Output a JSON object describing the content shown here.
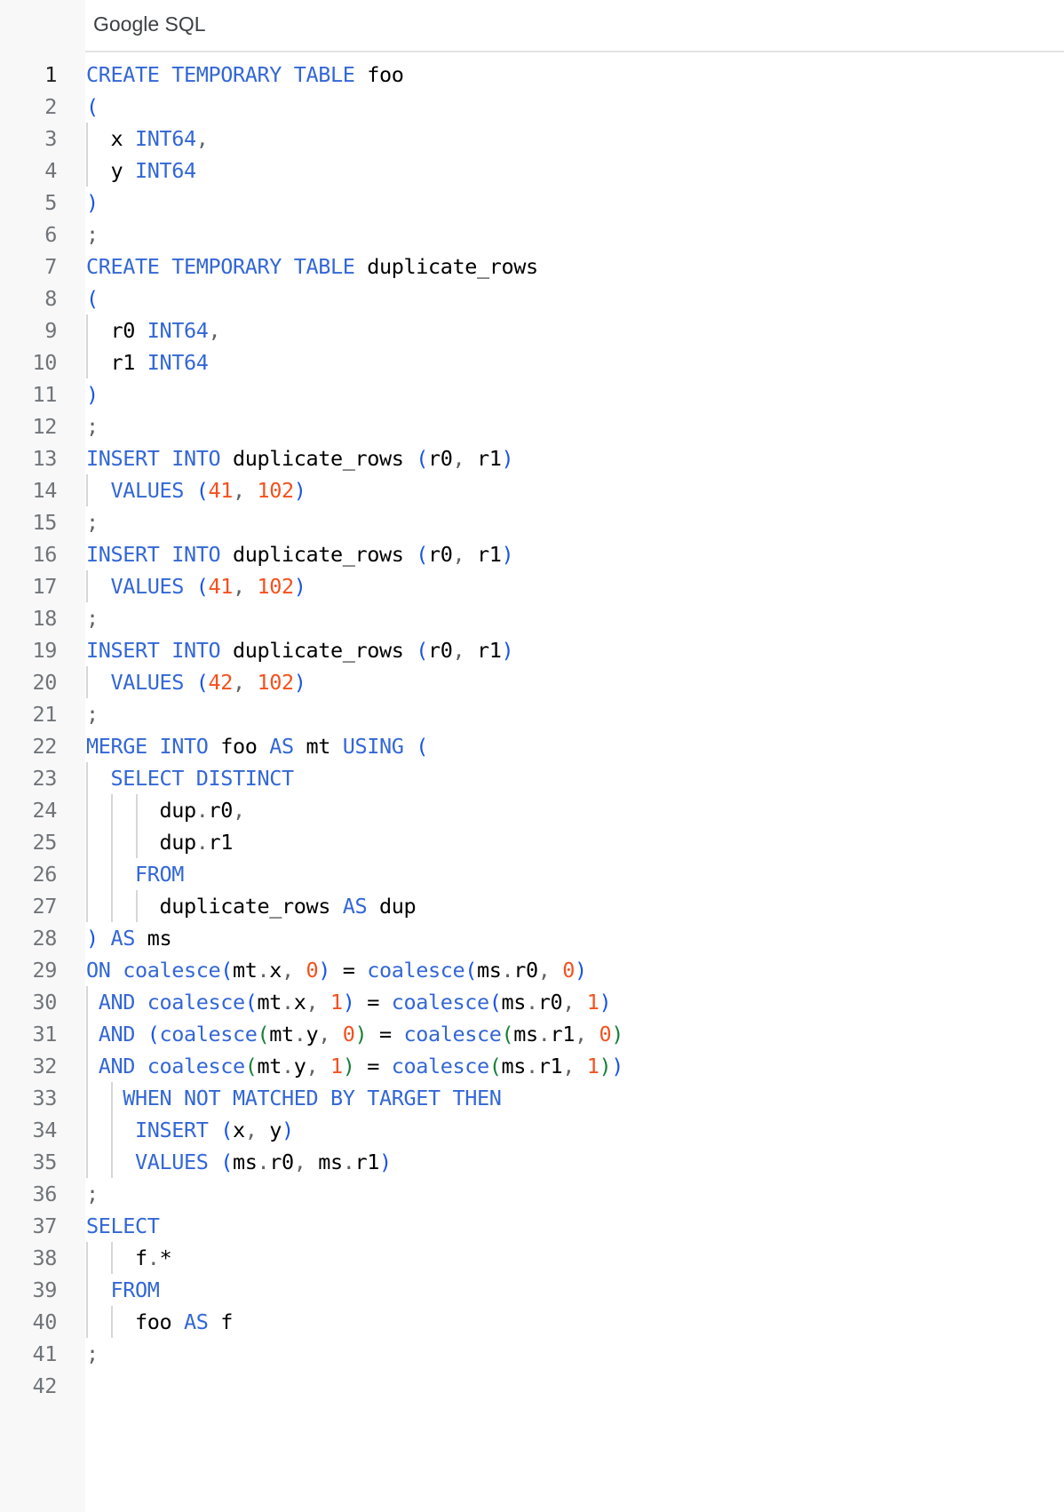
{
  "header": {
    "title": "Google SQL"
  },
  "editor": {
    "active_line": 1,
    "colors": {
      "keyword": "#3367d6",
      "paren_blue": "#1a55e6",
      "paren_green": "#188038",
      "number": "#f4511e",
      "identifier": "#000000",
      "punctuation": "#5f6368"
    },
    "lines": [
      {
        "n": "1",
        "guides": [],
        "tokens": [
          [
            "kw",
            "CREATE TEMPORARY TABLE"
          ],
          [
            "id",
            " foo"
          ]
        ]
      },
      {
        "n": "2",
        "guides": [],
        "tokens": [
          [
            "pb",
            "("
          ]
        ]
      },
      {
        "n": "3",
        "guides": [
          0
        ],
        "tokens": [
          [
            "id",
            "  x "
          ],
          [
            "kw",
            "INT64"
          ],
          [
            "punc",
            ","
          ]
        ]
      },
      {
        "n": "4",
        "guides": [
          0
        ],
        "tokens": [
          [
            "id",
            "  y "
          ],
          [
            "kw",
            "INT64"
          ]
        ]
      },
      {
        "n": "5",
        "guides": [],
        "tokens": [
          [
            "pb",
            ")"
          ]
        ]
      },
      {
        "n": "6",
        "guides": [],
        "tokens": [
          [
            "punc",
            ";"
          ]
        ]
      },
      {
        "n": "7",
        "guides": [],
        "tokens": [
          [
            "kw",
            "CREATE TEMPORARY TABLE"
          ],
          [
            "id",
            " duplicate_rows"
          ]
        ]
      },
      {
        "n": "8",
        "guides": [],
        "tokens": [
          [
            "pb",
            "("
          ]
        ]
      },
      {
        "n": "9",
        "guides": [
          0
        ],
        "tokens": [
          [
            "id",
            "  r0 "
          ],
          [
            "kw",
            "INT64"
          ],
          [
            "punc",
            ","
          ]
        ]
      },
      {
        "n": "10",
        "guides": [
          0
        ],
        "tokens": [
          [
            "id",
            "  r1 "
          ],
          [
            "kw",
            "INT64"
          ]
        ]
      },
      {
        "n": "11",
        "guides": [],
        "tokens": [
          [
            "pb",
            ")"
          ]
        ]
      },
      {
        "n": "12",
        "guides": [],
        "tokens": [
          [
            "punc",
            ";"
          ]
        ]
      },
      {
        "n": "13",
        "guides": [],
        "tokens": [
          [
            "kw",
            "INSERT INTO"
          ],
          [
            "id",
            " duplicate_rows "
          ],
          [
            "pb",
            "("
          ],
          [
            "id",
            "r0"
          ],
          [
            "punc",
            ", "
          ],
          [
            "id",
            "r1"
          ],
          [
            "pb",
            ")"
          ]
        ]
      },
      {
        "n": "14",
        "guides": [
          0
        ],
        "tokens": [
          [
            "id",
            "  "
          ],
          [
            "kw",
            "VALUES"
          ],
          [
            "id",
            " "
          ],
          [
            "pb",
            "("
          ],
          [
            "num",
            "41"
          ],
          [
            "punc",
            ", "
          ],
          [
            "num",
            "102"
          ],
          [
            "pb",
            ")"
          ]
        ]
      },
      {
        "n": "15",
        "guides": [],
        "tokens": [
          [
            "punc",
            ";"
          ]
        ]
      },
      {
        "n": "16",
        "guides": [],
        "tokens": [
          [
            "kw",
            "INSERT INTO"
          ],
          [
            "id",
            " duplicate_rows "
          ],
          [
            "pb",
            "("
          ],
          [
            "id",
            "r0"
          ],
          [
            "punc",
            ", "
          ],
          [
            "id",
            "r1"
          ],
          [
            "pb",
            ")"
          ]
        ]
      },
      {
        "n": "17",
        "guides": [
          0
        ],
        "tokens": [
          [
            "id",
            "  "
          ],
          [
            "kw",
            "VALUES"
          ],
          [
            "id",
            " "
          ],
          [
            "pb",
            "("
          ],
          [
            "num",
            "41"
          ],
          [
            "punc",
            ", "
          ],
          [
            "num",
            "102"
          ],
          [
            "pb",
            ")"
          ]
        ]
      },
      {
        "n": "18",
        "guides": [],
        "tokens": [
          [
            "punc",
            ";"
          ]
        ]
      },
      {
        "n": "19",
        "guides": [],
        "tokens": [
          [
            "kw",
            "INSERT INTO"
          ],
          [
            "id",
            " duplicate_rows "
          ],
          [
            "pb",
            "("
          ],
          [
            "id",
            "r0"
          ],
          [
            "punc",
            ", "
          ],
          [
            "id",
            "r1"
          ],
          [
            "pb",
            ")"
          ]
        ]
      },
      {
        "n": "20",
        "guides": [
          0
        ],
        "tokens": [
          [
            "id",
            "  "
          ],
          [
            "kw",
            "VALUES"
          ],
          [
            "id",
            " "
          ],
          [
            "pb",
            "("
          ],
          [
            "num",
            "42"
          ],
          [
            "punc",
            ", "
          ],
          [
            "num",
            "102"
          ],
          [
            "pb",
            ")"
          ]
        ]
      },
      {
        "n": "21",
        "guides": [],
        "tokens": [
          [
            "punc",
            ";"
          ]
        ]
      },
      {
        "n": "22",
        "guides": [],
        "tokens": [
          [
            "kw",
            "MERGE INTO"
          ],
          [
            "id",
            " foo "
          ],
          [
            "kw",
            "AS"
          ],
          [
            "id",
            " mt "
          ],
          [
            "kw",
            "USING"
          ],
          [
            "id",
            " "
          ],
          [
            "pb",
            "("
          ]
        ]
      },
      {
        "n": "23",
        "guides": [
          0
        ],
        "tokens": [
          [
            "id",
            "  "
          ],
          [
            "kw",
            "SELECT DISTINCT"
          ]
        ]
      },
      {
        "n": "24",
        "guides": [
          0,
          2,
          4
        ],
        "tokens": [
          [
            "id",
            "      dup"
          ],
          [
            "punc",
            "."
          ],
          [
            "id",
            "r0"
          ],
          [
            "punc",
            ","
          ]
        ]
      },
      {
        "n": "25",
        "guides": [
          0,
          2,
          4
        ],
        "tokens": [
          [
            "id",
            "      dup"
          ],
          [
            "punc",
            "."
          ],
          [
            "id",
            "r1"
          ]
        ]
      },
      {
        "n": "26",
        "guides": [
          0,
          2
        ],
        "tokens": [
          [
            "id",
            "    "
          ],
          [
            "kw",
            "FROM"
          ]
        ]
      },
      {
        "n": "27",
        "guides": [
          0,
          2,
          4
        ],
        "tokens": [
          [
            "id",
            "      duplicate_rows "
          ],
          [
            "kw",
            "AS"
          ],
          [
            "id",
            " dup"
          ]
        ]
      },
      {
        "n": "28",
        "guides": [],
        "tokens": [
          [
            "pb",
            ")"
          ],
          [
            "id",
            " "
          ],
          [
            "kw",
            "AS"
          ],
          [
            "id",
            " ms"
          ]
        ]
      },
      {
        "n": "29",
        "guides": [],
        "tokens": [
          [
            "kw",
            "ON coalesce"
          ],
          [
            "pb",
            "("
          ],
          [
            "id",
            "mt"
          ],
          [
            "punc",
            "."
          ],
          [
            "id",
            "x"
          ],
          [
            "punc",
            ", "
          ],
          [
            "num",
            "0"
          ],
          [
            "pb",
            ")"
          ],
          [
            "id",
            " = "
          ],
          [
            "kw",
            "coalesce"
          ],
          [
            "pb",
            "("
          ],
          [
            "id",
            "ms"
          ],
          [
            "punc",
            "."
          ],
          [
            "id",
            "r0"
          ],
          [
            "punc",
            ", "
          ],
          [
            "num",
            "0"
          ],
          [
            "pb",
            ")"
          ]
        ]
      },
      {
        "n": "30",
        "guides": [
          0
        ],
        "tokens": [
          [
            "id",
            " "
          ],
          [
            "kw",
            "AND coalesce"
          ],
          [
            "pb",
            "("
          ],
          [
            "id",
            "mt"
          ],
          [
            "punc",
            "."
          ],
          [
            "id",
            "x"
          ],
          [
            "punc",
            ", "
          ],
          [
            "num",
            "1"
          ],
          [
            "pb",
            ")"
          ],
          [
            "id",
            " = "
          ],
          [
            "kw",
            "coalesce"
          ],
          [
            "pb",
            "("
          ],
          [
            "id",
            "ms"
          ],
          [
            "punc",
            "."
          ],
          [
            "id",
            "r0"
          ],
          [
            "punc",
            ", "
          ],
          [
            "num",
            "1"
          ],
          [
            "pb",
            ")"
          ]
        ]
      },
      {
        "n": "31",
        "guides": [
          0
        ],
        "tokens": [
          [
            "id",
            " "
          ],
          [
            "kw",
            "AND"
          ],
          [
            "id",
            " "
          ],
          [
            "pb",
            "("
          ],
          [
            "kw",
            "coalesce"
          ],
          [
            "pg",
            "("
          ],
          [
            "id",
            "mt"
          ],
          [
            "punc",
            "."
          ],
          [
            "id",
            "y"
          ],
          [
            "punc",
            ", "
          ],
          [
            "num",
            "0"
          ],
          [
            "pg",
            ")"
          ],
          [
            "id",
            " = "
          ],
          [
            "kw",
            "coalesce"
          ],
          [
            "pg",
            "("
          ],
          [
            "id",
            "ms"
          ],
          [
            "punc",
            "."
          ],
          [
            "id",
            "r1"
          ],
          [
            "punc",
            ", "
          ],
          [
            "num",
            "0"
          ],
          [
            "pg",
            ")"
          ]
        ]
      },
      {
        "n": "32",
        "guides": [
          0
        ],
        "tokens": [
          [
            "id",
            " "
          ],
          [
            "kw",
            "AND coalesce"
          ],
          [
            "pg",
            "("
          ],
          [
            "id",
            "mt"
          ],
          [
            "punc",
            "."
          ],
          [
            "id",
            "y"
          ],
          [
            "punc",
            ", "
          ],
          [
            "num",
            "1"
          ],
          [
            "pg",
            ")"
          ],
          [
            "id",
            " = "
          ],
          [
            "kw",
            "coalesce"
          ],
          [
            "pg",
            "("
          ],
          [
            "id",
            "ms"
          ],
          [
            "punc",
            "."
          ],
          [
            "id",
            "r1"
          ],
          [
            "punc",
            ", "
          ],
          [
            "num",
            "1"
          ],
          [
            "pg",
            ")"
          ],
          [
            "pb",
            ")"
          ]
        ]
      },
      {
        "n": "33",
        "guides": [
          0,
          2
        ],
        "tokens": [
          [
            "id",
            "   "
          ],
          [
            "kw",
            "WHEN NOT MATCHED BY TARGET THEN"
          ]
        ]
      },
      {
        "n": "34",
        "guides": [
          0,
          2
        ],
        "tokens": [
          [
            "id",
            "    "
          ],
          [
            "kw",
            "INSERT"
          ],
          [
            "id",
            " "
          ],
          [
            "pb",
            "("
          ],
          [
            "id",
            "x"
          ],
          [
            "punc",
            ", "
          ],
          [
            "id",
            "y"
          ],
          [
            "pb",
            ")"
          ]
        ]
      },
      {
        "n": "35",
        "guides": [
          0,
          2
        ],
        "tokens": [
          [
            "id",
            "    "
          ],
          [
            "kw",
            "VALUES"
          ],
          [
            "id",
            " "
          ],
          [
            "pb",
            "("
          ],
          [
            "id",
            "ms"
          ],
          [
            "punc",
            "."
          ],
          [
            "id",
            "r0"
          ],
          [
            "punc",
            ", "
          ],
          [
            "id",
            "ms"
          ],
          [
            "punc",
            "."
          ],
          [
            "id",
            "r1"
          ],
          [
            "pb",
            ")"
          ]
        ]
      },
      {
        "n": "36",
        "guides": [],
        "tokens": [
          [
            "punc",
            ";"
          ]
        ]
      },
      {
        "n": "37",
        "guides": [],
        "tokens": [
          [
            "kw",
            "SELECT"
          ]
        ]
      },
      {
        "n": "38",
        "guides": [
          0,
          2
        ],
        "tokens": [
          [
            "id",
            "    f"
          ],
          [
            "punc",
            "."
          ],
          [
            "id",
            "*"
          ]
        ]
      },
      {
        "n": "39",
        "guides": [
          0
        ],
        "tokens": [
          [
            "id",
            "  "
          ],
          [
            "kw",
            "FROM"
          ]
        ]
      },
      {
        "n": "40",
        "guides": [
          0,
          2
        ],
        "tokens": [
          [
            "id",
            "    foo "
          ],
          [
            "kw",
            "AS"
          ],
          [
            "id",
            " f"
          ]
        ]
      },
      {
        "n": "41",
        "guides": [],
        "tokens": [
          [
            "punc",
            ";"
          ]
        ]
      },
      {
        "n": "42",
        "guides": [],
        "tokens": []
      }
    ]
  }
}
